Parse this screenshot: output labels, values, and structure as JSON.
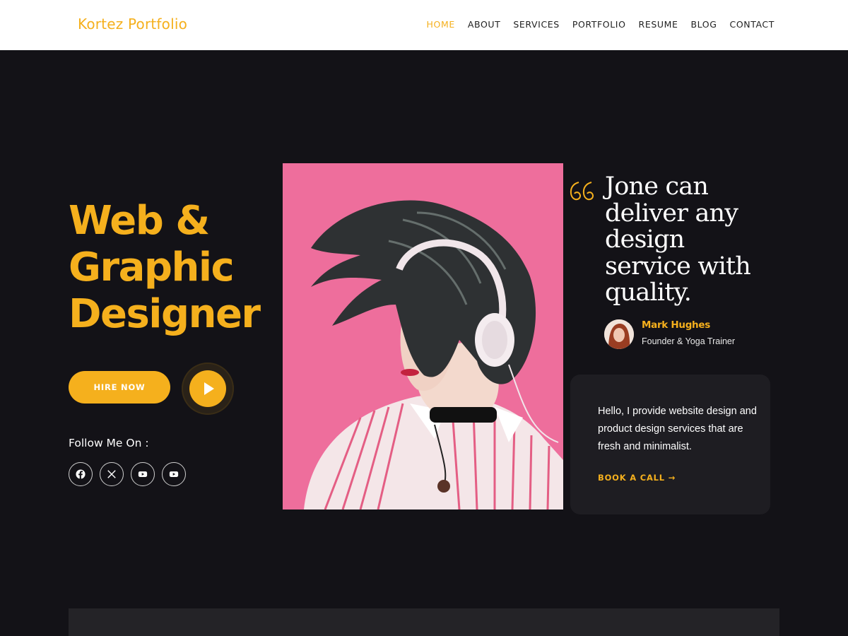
{
  "header": {
    "logo": "Kortez Portfolio",
    "nav": [
      "HOME",
      "ABOUT",
      "SERVICES",
      "PORTFOLIO",
      "RESUME",
      "BLOG",
      "CONTACT"
    ],
    "active_nav": "HOME"
  },
  "hero": {
    "title_lines": [
      "Web &",
      "Graphic",
      "Designer"
    ],
    "hire_button": "HIRE NOW",
    "follow_label": "Follow Me On :",
    "socials": [
      "facebook-icon",
      "x-icon",
      "youtube-icon",
      "youtube-icon"
    ]
  },
  "testimonial": {
    "quote": "Jone can deliver any design service with quality.",
    "author_name": "Mark Hughes",
    "author_role": "Founder & Yoga Trainer"
  },
  "card": {
    "text": "Hello, I provide website design and product design services that are fresh and minimalist.",
    "link": "BOOK A CALL →"
  },
  "colors": {
    "accent": "#f5b01d",
    "background": "#131217",
    "card": "#1e1d22",
    "photo_bg": "#ee6e9c"
  }
}
